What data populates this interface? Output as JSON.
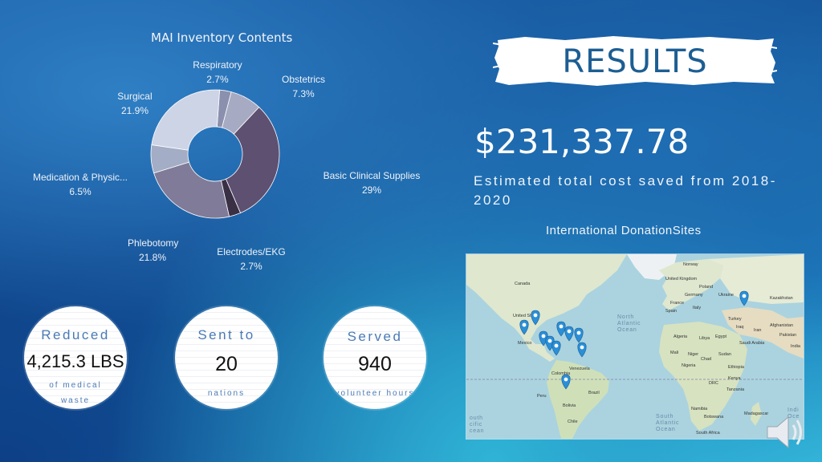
{
  "chart": {
    "title": "MAI Inventory Contents"
  },
  "chart_data": {
    "type": "pie",
    "title": "MAI Inventory Contents",
    "categories": [
      "Respiratory",
      "Obstetrics",
      "Basic Clinical Supplies",
      "Electrodes/EKG",
      "Phlebotomy",
      "Medication & Physic...",
      "Surgical"
    ],
    "values": [
      2.7,
      7.3,
      29,
      2.7,
      21.8,
      6.5,
      21.9
    ],
    "value_labels": [
      "2.7%",
      "7.3%",
      "29%",
      "2.7%",
      "21.8%",
      "6.5%",
      "21.9%"
    ],
    "colors": [
      "#8a90ad",
      "#a6aac2",
      "#5e5071",
      "#3a3046",
      "#7f7b98",
      "#a4adc6",
      "#cdd4e6"
    ],
    "donut": true,
    "legend": "none"
  },
  "results": {
    "heading": "RESULTS",
    "amount": "$231,337.78",
    "description": "Estimated total cost saved from 2018-2020"
  },
  "map": {
    "title": "International DonationSites",
    "labels": {
      "norway": "Norway",
      "united_kingdom": "United Kingdom",
      "poland": "Poland",
      "germany": "Germany",
      "ukraine": "Ukraine",
      "kazakhstan": "Kazakhstan",
      "france": "France",
      "italy": "Italy",
      "spain": "Spain",
      "turkey": "Turkey",
      "iraq": "Iraq",
      "iran": "Iran",
      "afghanistan": "Afghanistan",
      "pakistan": "Pakistan",
      "algeria": "Algeria",
      "libya": "Libya",
      "egypt": "Egypt",
      "saudi_arabia": "Saudi Arabia",
      "india": "India",
      "mali": "Mali",
      "niger": "Niger",
      "chad": "Chad",
      "sudan": "Sudan",
      "nigeria": "Nigeria",
      "ethiopia": "Ethiopia",
      "drc": "DRC",
      "kenya": "Kenya",
      "tanzania": "Tanzania",
      "namibia": "Namibia",
      "botswana": "Botswana",
      "madagascar": "Madagascar",
      "south_africa": "South Africa",
      "canada": "Canada",
      "united_states": "United States",
      "mexico": "Mexico",
      "colombia": "Colombia",
      "venezuela": "Venezuela",
      "peru": "Peru",
      "brazil": "Brazil",
      "bolivia": "Bolivia",
      "chile": "Chile",
      "north_atlantic_ocean": "North Atlantic Ocean",
      "south_atlantic_ocean": "South Atlantic Ocean",
      "south_pacific_ocean": "outh cific cean",
      "indian_ocean": "Indi Oce"
    },
    "marker_count": 11,
    "marker_color": "#2a8fd6"
  },
  "stats": [
    {
      "heading": "Reduced",
      "value": "4,215.3 LBS",
      "sub1": "of medical",
      "sub2": "waste"
    },
    {
      "heading": "Sent to",
      "value": "20",
      "sub1": "nations"
    },
    {
      "heading": "Served",
      "value": "940",
      "sub1": "volunteer hours"
    }
  ],
  "icons": {
    "speaker": "speaker-icon"
  }
}
